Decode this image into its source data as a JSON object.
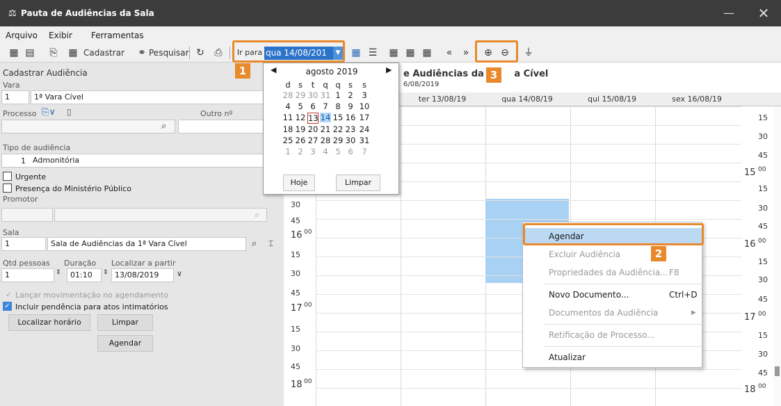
{
  "window": {
    "title": "Pauta de Audiências da Sala",
    "minimize": "—",
    "close": "✕"
  },
  "menu": [
    "Arquivo",
    "Exibir",
    "Ferramentas"
  ],
  "toolbar": {
    "cadastrar": "Cadastrar",
    "pesquisar": "Pesquisar",
    "ir_para": "Ir para",
    "date_value": "qua 14/08/201"
  },
  "annotations": [
    "1",
    "2",
    "3"
  ],
  "left": {
    "title": "Cadastrar Audiência",
    "vara_label": "Vara",
    "vara_code": "1",
    "vara_name": "1ª Vara Cível",
    "processo_label": "Processo",
    "outro_label": "Outro nº",
    "tipo_label": "Tipo de audiência",
    "tipo_code": "1",
    "tipo_name": "Admonitória",
    "urgente": "Urgente",
    "presenca": "Presença do Ministério Público",
    "promotor_label": "Promotor",
    "sala_label": "Sala",
    "sala_code": "1",
    "sala_name": "Sala de Audiências da 1ª Vara Cível",
    "qtd_label": "Qtd pessoas",
    "qtd_value": "1",
    "duracao_label": "Duração",
    "duracao_value": "01:10",
    "localizar_label": "Localizar a partir",
    "localizar_value": "13/08/2019",
    "lancar": "Lançar movimentação no agendamento",
    "incluir": "Incluir pendência para atos intimatórios",
    "btn_localizar": "Localizar horário",
    "btn_limpar": "Limpar",
    "btn_agendar": "Agendar"
  },
  "calendar": {
    "month": "agosto 2019",
    "weekdays": [
      "d",
      "s",
      "t",
      "q",
      "q",
      "s",
      "s"
    ],
    "weeks": [
      [
        "28",
        "29",
        "30",
        "31",
        "1",
        "2",
        "3"
      ],
      [
        "4",
        "5",
        "6",
        "7",
        "8",
        "9",
        "10"
      ],
      [
        "11",
        "12",
        "13",
        "14",
        "15",
        "16",
        "17"
      ],
      [
        "18",
        "19",
        "20",
        "21",
        "22",
        "23",
        "24"
      ],
      [
        "25",
        "26",
        "27",
        "28",
        "29",
        "30",
        "31"
      ],
      [
        "1",
        "2",
        "3",
        "4",
        "5",
        "6",
        "7"
      ]
    ],
    "today": "13",
    "selected": "14",
    "btn_hoje": "Hoje",
    "btn_limpar": "Limpar"
  },
  "schedule": {
    "title": "e Audiências da 1ª",
    "title_tail": "a Cível",
    "subtitle": "6/08/2019",
    "days": [
      "ter 13/08/19",
      "qua 14/08/19",
      "qui 15/08/19",
      "sex 16/08/19"
    ],
    "left_times": [
      [
        "30",
        "295"
      ],
      [
        "45",
        "316"
      ],
      [
        "16",
        "339"
      ],
      [
        "15",
        "365"
      ],
      [
        "30",
        "392"
      ],
      [
        "45",
        "420"
      ],
      [
        "17",
        "443"
      ],
      [
        "15",
        "472"
      ],
      [
        "30",
        "500"
      ],
      [
        "45",
        "526"
      ],
      [
        "18",
        "551"
      ]
    ],
    "right_times": [
      "15",
      "30",
      "45",
      "15",
      "15",
      "30",
      "45",
      "16",
      "15",
      "30",
      "45",
      "17",
      "15",
      "30",
      "45",
      "18"
    ]
  },
  "context_menu": {
    "agendar": "Agendar",
    "excluir": "Excluir Audiência",
    "propriedades": "Propriedades da Audiência...",
    "propriedades_sc": "F8",
    "novo": "Novo Documento...",
    "novo_sc": "Ctrl+D",
    "documentos": "Documentos da Audiência",
    "retificacao": "Retificação de Processo...",
    "atualizar": "Atualizar"
  },
  "colors": {
    "accent": "#e8892b",
    "selection": "#a9d1f3",
    "titlebar": "#3c3c3c"
  }
}
